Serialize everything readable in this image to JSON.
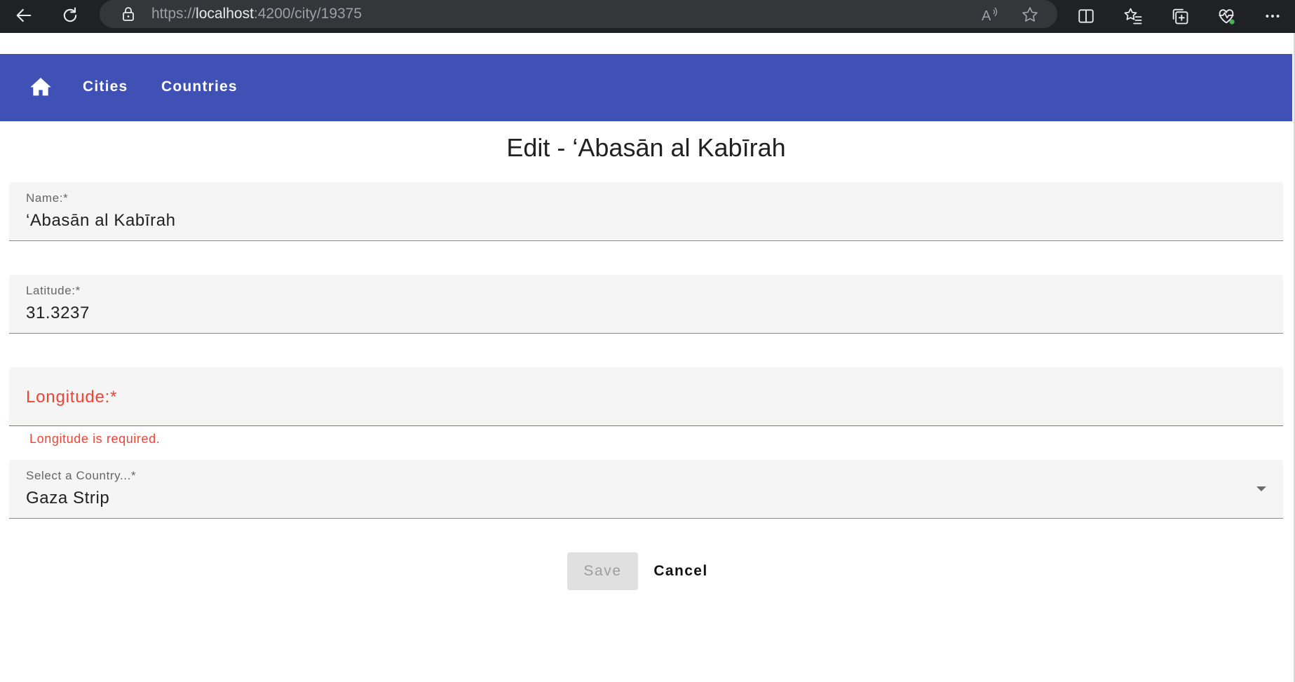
{
  "browser": {
    "url_scheme": "https://",
    "url_host": "localhost",
    "url_path": ":4200/city/19375",
    "icons": [
      "back-icon",
      "reload-icon",
      "lock-icon",
      "read-aloud-icon",
      "favorite-star-icon",
      "split-screen-icon",
      "favorites-icon",
      "collections-icon",
      "browser-health-icon",
      "more-icon"
    ],
    "colors": {
      "frame": "#202124",
      "address_bar": "#35363a"
    }
  },
  "app_toolbar": {
    "color": "#3f51b5",
    "home_icon": "home-icon",
    "nav": [
      {
        "label": "Cities"
      },
      {
        "label": "Countries"
      }
    ]
  },
  "page": {
    "title": "Edit - ‘Abasān al Kabīrah"
  },
  "form": {
    "name": {
      "label": "Name:*",
      "value": "‘Abasān al Kabīrah"
    },
    "latitude": {
      "label": "Latitude:*",
      "value": "31.3237"
    },
    "longitude": {
      "label": "Longitude:*",
      "value": "",
      "error": "Longitude is required.",
      "error_color": "#f44336"
    },
    "country": {
      "label": "Select a Country...*",
      "value": "Gaza Strip",
      "icon": "dropdown-arrow-icon"
    }
  },
  "actions": {
    "save_label": "Save",
    "save_disabled": true,
    "cancel_label": "Cancel"
  }
}
